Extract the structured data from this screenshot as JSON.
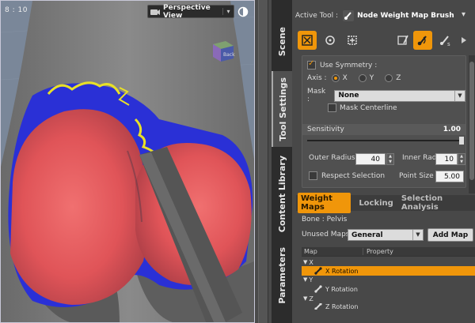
{
  "viewport": {
    "frame_label": "8 : 10",
    "view_name": "Perspective View",
    "cube_label": "Back",
    "view_arrow": "▾"
  },
  "tabs": [
    "Scene",
    "Tool Settings",
    "Content Library",
    "Parameters"
  ],
  "panel": {
    "active_tool_label": "Active Tool :",
    "active_tool_name": "Node Weight Map Brush",
    "menu_glyph": "▾",
    "settings": {
      "use_symmetry_label": "Use Symmetry :",
      "use_symmetry_checked": true,
      "axis_label": "Axis :",
      "axis_options": [
        "X",
        "Y",
        "Z"
      ],
      "axis_selected": "X",
      "mask_label": "Mask :",
      "mask_value": "None",
      "mask_centerline_label": "Mask Centerline",
      "sensitivity_label": "Sensitivity",
      "sensitivity_value": "1.00",
      "outer_radius_label": "Outer Radius :",
      "outer_radius_value": "40",
      "inner_radius_label": "Inner Radius :",
      "inner_radius_value": "10",
      "respect_selection_label": "Respect Selection",
      "point_size_label": "Point Size :",
      "point_size_value": "5.00"
    },
    "weight_tabs": [
      "Weight Maps",
      "Locking",
      "Selection Analysis"
    ],
    "bone_label": "Bone : Pelvis",
    "unused_maps_label": "Unused Maps :",
    "unused_maps_value": "General",
    "add_map_label": "Add Map",
    "table_headers": [
      "Map",
      "Property"
    ],
    "tree": [
      {
        "group": "X",
        "item": "X Rotation",
        "selected": true
      },
      {
        "group": "Y",
        "item": "Y Rotation",
        "selected": false
      },
      {
        "group": "Z",
        "item": "Z Rotation",
        "selected": false
      }
    ]
  },
  "colors": {
    "accent": "#f0960a",
    "weight_high": "#e8585a",
    "weight_low": "#2828d8",
    "weight_mid": "#e8e028"
  }
}
